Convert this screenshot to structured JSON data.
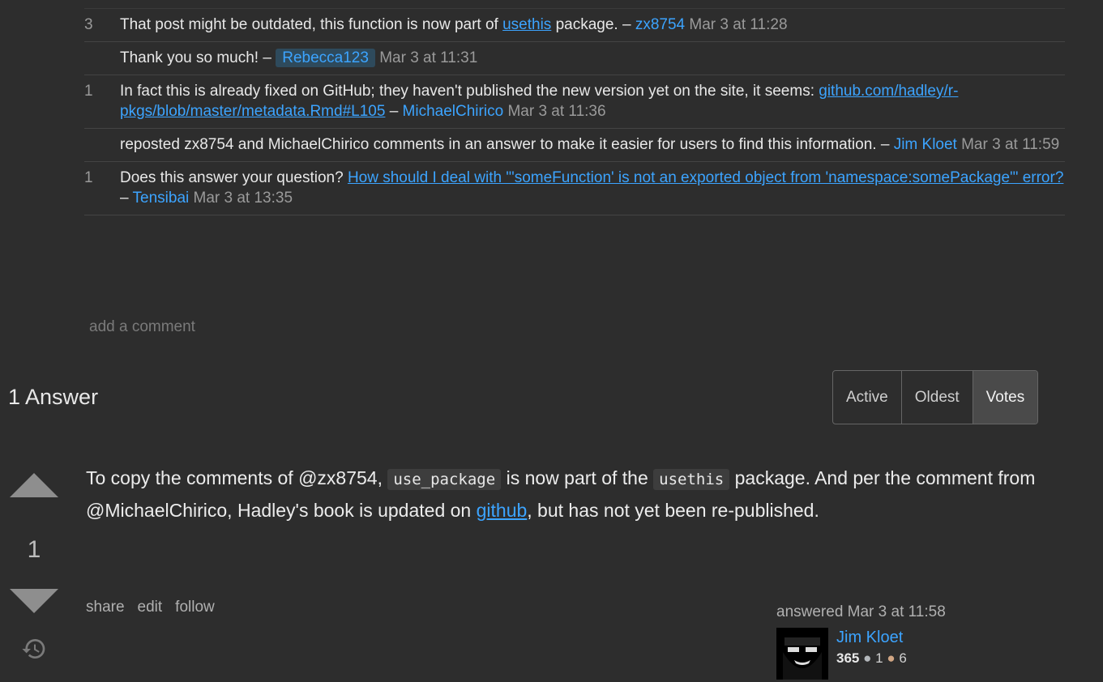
{
  "comments": [
    {
      "score": "3",
      "text": "That post might be outdated, this function is now part of ",
      "link": "usethis",
      "after": " package. – ",
      "user": "zx8754",
      "date": "Mar 3 at 11:28"
    },
    {
      "score": "",
      "text": "Thank you so much! – ",
      "user": "Rebecca123",
      "date": "Mar 3 at 11:31"
    },
    {
      "score": "1",
      "text": "In fact this is already fixed on GitHub; they haven't published the new version yet on the site, it seems: ",
      "link": "github.com/hadley/r-pkgs/blob/master/metadata.Rmd#L105",
      "after": " – ",
      "user": "MichaelChirico",
      "date": "Mar 3 at 11:36"
    },
    {
      "score": "",
      "text": "reposted zx8754 and MichaelChirico comments in an answer to make it easier for users to find this information. – ",
      "user": "Jim Kloet",
      "date": "Mar 3 at 11:59"
    },
    {
      "score": "1",
      "text": "Does this answer your question? ",
      "link": "How should I deal with \"'someFunction' is not an exported object from 'namespace:somePackage'\" error?",
      "after": " – ",
      "user": "Tensibai",
      "date": "Mar 3 at 13:35"
    }
  ],
  "add_comment": "add a comment",
  "answers_title": "1 Answer",
  "sort_tabs": [
    "Active",
    "Oldest",
    "Votes"
  ],
  "answer": {
    "votes": "1",
    "part1": "To copy the comments of @zx8754, ",
    "code1": "use_package",
    "part2": " is now part of the ",
    "code2": "usethis",
    "part3": " package. And per the comment from @MichaelChirico, Hadley's book is updated on ",
    "link": "github",
    "part4": ", but has not yet been re-published."
  },
  "post_menu": [
    "share",
    "edit",
    "follow"
  ],
  "user_card": {
    "answered": "answered Mar 3 at 11:58",
    "name": "Jim Kloet",
    "rep": "365",
    "silver": "1",
    "bronze": "6"
  }
}
